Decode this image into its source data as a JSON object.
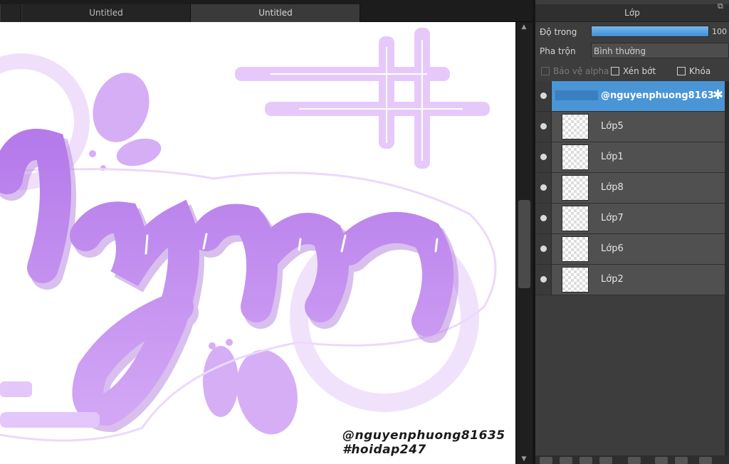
{
  "tabs": [
    {
      "label": "Untitled",
      "active": false
    },
    {
      "label": "Untitled",
      "active": true
    }
  ],
  "canvas": {
    "credit_line1": "@nguyenphuong81635",
    "credit_line2": "#hoidap247"
  },
  "layers_panel": {
    "title": "Lớp",
    "opacity_label": "Độ trong",
    "opacity_value": "100",
    "blend_label": "Pha trộn",
    "blend_value": "Bình thường",
    "protect_alpha_label": "Bảo vệ alpha",
    "clip_label": "Xén bớt",
    "lock_label": "Khóa",
    "layers": [
      {
        "name": "@nguyenphuong8163",
        "selected": true
      },
      {
        "name": "Lớp5",
        "selected": false
      },
      {
        "name": "Lớp1",
        "selected": false
      },
      {
        "name": "Lớp8",
        "selected": false
      },
      {
        "name": "Lớp7",
        "selected": false
      },
      {
        "name": "Lớp6",
        "selected": false
      },
      {
        "name": "Lớp2",
        "selected": false
      }
    ]
  },
  "colors": {
    "accent_blue": "#4a95d6",
    "lettering_purple": "#c48ef0",
    "outline_lilac": "#ead4fb"
  }
}
